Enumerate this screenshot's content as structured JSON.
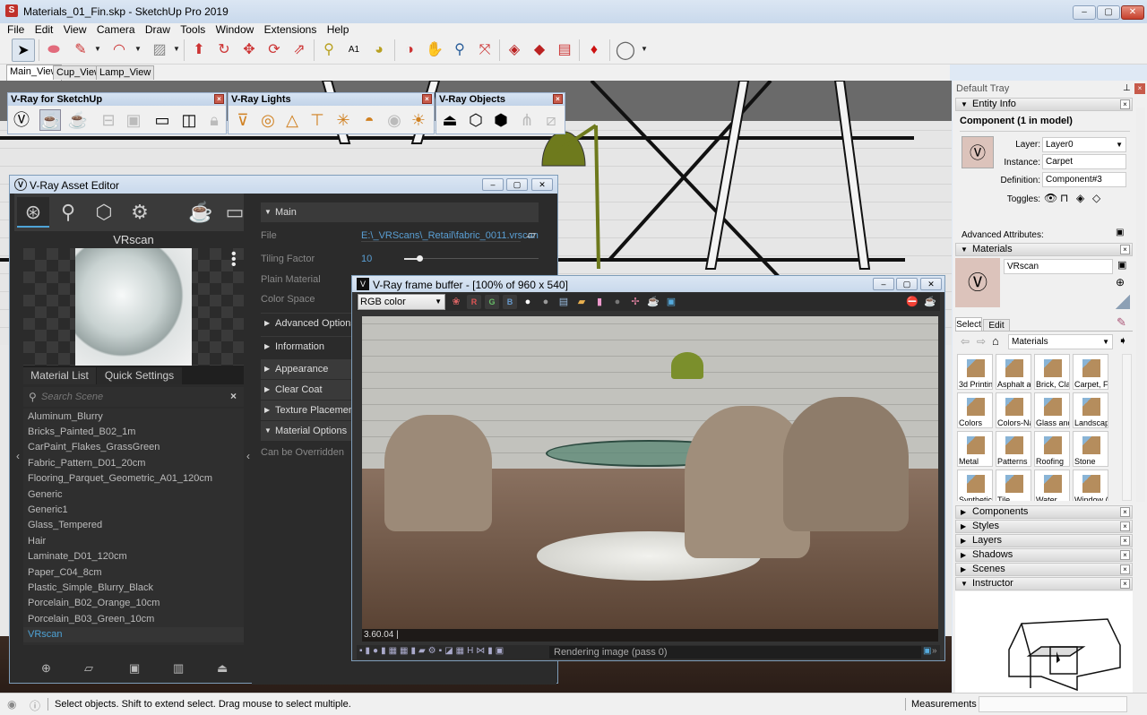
{
  "window": {
    "title": "Materials_01_Fin.skp - SketchUp Pro 2019",
    "app_icon": "sketchup-icon",
    "controls": {
      "minimize": "–",
      "maximize": "▢",
      "close": "✕"
    }
  },
  "menu": [
    "File",
    "Edit",
    "View",
    "Camera",
    "Draw",
    "Tools",
    "Window",
    "Extensions",
    "Help"
  ],
  "toolbar": {
    "icons": [
      "select-icon",
      "eraser-icon",
      "pencil-icon",
      "arc-icon",
      "rectangle-icon",
      "push-pull-icon",
      "follow-me-icon",
      "move-icon",
      "rotate-icon",
      "scale-icon",
      "tape-measure-icon",
      "text-icon",
      "paint-bucket-icon",
      "orbit-icon",
      "pan-icon",
      "zoom-icon",
      "zoom-extents-icon",
      "3d-warehouse-icon",
      "extension-warehouse-icon",
      "send-to-layout-icon",
      "extension-manager-icon",
      "account-icon"
    ]
  },
  "scene_tabs": [
    "Main_View",
    "Cup_View",
    "Lamp_View"
  ],
  "vray_toolbars": [
    {
      "title": "V-Ray for SketchUp"
    },
    {
      "title": "V-Ray Lights"
    },
    {
      "title": "V-Ray Objects"
    }
  ],
  "asset_editor": {
    "title": "V-Ray Asset Editor",
    "categories": [
      "materials-icon",
      "lights-icon",
      "geometry-icon",
      "settings-icon",
      "render-icon",
      "frame-buffer-icon"
    ],
    "preview_name": "VRscan",
    "tabs": [
      "Material List",
      "Quick Settings"
    ],
    "search_placeholder": "Search Scene",
    "materials": [
      "Aluminum_Blurry",
      "Bricks_Painted_B02_1m",
      "CarPaint_Flakes_GrassGreen",
      "Fabric_Pattern_D01_20cm",
      "Flooring_Parquet_Geometric_A01_120cm",
      "Generic",
      "Generic1",
      "Glass_Tempered",
      "Hair",
      "Laminate_D01_120cm",
      "Paper_C04_8cm",
      "Plastic_Simple_Blurry_Black",
      "Porcelain_B02_Orange_10cm",
      "Porcelain_B03_Green_10cm",
      "VRscan"
    ],
    "selected_material": "VRscan",
    "props": {
      "main_section": "Main",
      "file_label": "File",
      "file_value": "E:\\_VRScans\\_Retail\\fabric_0011.vrscan",
      "tiling_label": "Tiling Factor",
      "tiling_value": "10",
      "plain_material_label": "Plain Material",
      "color_space_label": "Color Space",
      "sections": [
        "Advanced Options",
        "Information",
        "Appearance",
        "Clear Coat",
        "Texture Placement",
        "Material Options"
      ],
      "override_label": "Can be Overridden"
    }
  },
  "frame_buffer": {
    "title": "V-Ray frame buffer - [100% of 960 x 540]",
    "channel": "RGB color",
    "channels": [
      "R",
      "G",
      "B"
    ],
    "readout": "3.60.04 |",
    "status": "Rendering image (pass 0)"
  },
  "tray": {
    "title": "Default Tray",
    "entity_info": {
      "header": "Entity Info",
      "heading": "Component (1 in model)",
      "layer_label": "Layer:",
      "layer_value": "Layer0",
      "instance_label": "Instance:",
      "instance_value": "Carpet",
      "definition_label": "Definition:",
      "definition_value": "Component#3",
      "toggles_label": "Toggles:",
      "advanced_label": "Advanced Attributes:"
    },
    "materials": {
      "header": "Materials",
      "name_value": "VRscan",
      "tabs": [
        "Select",
        "Edit"
      ],
      "collection": "Materials",
      "folders": [
        "3d Printin",
        "Asphalt a",
        "Brick, Cla",
        "Carpet, F",
        "Colors",
        "Colors-Na",
        "Glass and",
        "Landscap",
        "Metal",
        "Patterns",
        "Roofing",
        "Stone",
        "Synthetic",
        "Tile",
        "Water",
        "Window ("
      ]
    },
    "collapsed_panels": [
      "Components",
      "Styles",
      "Layers",
      "Shadows",
      "Scenes"
    ],
    "instructor": "Instructor"
  },
  "statusbar": {
    "message": "Select objects. Shift to extend select. Drag mouse to select multiple.",
    "measurements_label": "Measurements",
    "measurements_value": ""
  }
}
